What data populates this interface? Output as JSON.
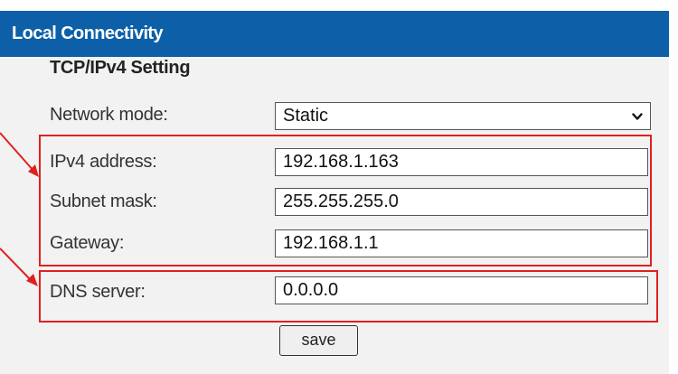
{
  "header": {
    "title": "Local Connectivity"
  },
  "section": {
    "title": "TCP/IPv4 Setting"
  },
  "network_mode": {
    "label": "Network mode:",
    "value": "Static"
  },
  "ipv4": {
    "label": "IPv4 address:",
    "value": "192.168.1.163"
  },
  "subnet": {
    "label": "Subnet mask:",
    "value": "255.255.255.0"
  },
  "gateway": {
    "label": "Gateway:",
    "value": "192.168.1.1"
  },
  "dns": {
    "label": "DNS server:",
    "value": "0.0.0.0"
  },
  "save": {
    "label": "save"
  },
  "colors": {
    "header_bg": "#0d5fa8",
    "annotation": "#e02020",
    "panel_bg": "#f2f2f2"
  }
}
